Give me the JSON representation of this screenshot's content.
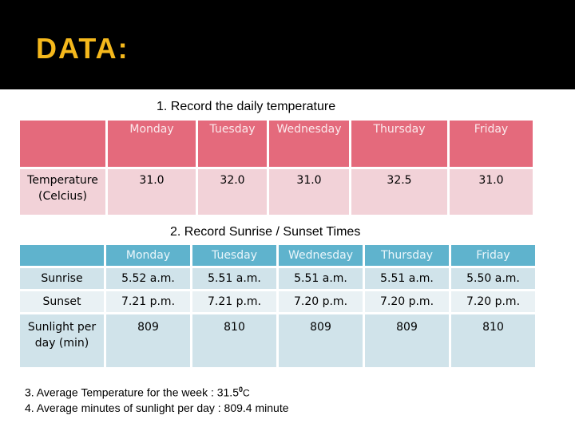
{
  "slide": {
    "title": "DATA:",
    "title_color": "#f5b81c"
  },
  "section1": {
    "caption": "1. Record the daily temperature",
    "header": [
      "",
      "Monday",
      "Tuesday",
      "Wednesday",
      "Thursday",
      "Friday"
    ],
    "rows": [
      {
        "label_line1": "Temperature",
        "label_line2": "(Celcius)",
        "values": [
          "31.0",
          "32.0",
          "31.0",
          "32.5",
          "31.0"
        ]
      }
    ],
    "colors": {
      "header": "#e46a7c",
      "body": "#f2d2d8"
    }
  },
  "section2": {
    "caption": "2. Record Sunrise / Sunset Times",
    "header": [
      "",
      "Monday",
      "Tuesday",
      "Wednesday",
      "Thursday",
      "Friday"
    ],
    "rows": [
      {
        "label_line1": "Sunrise",
        "label_line2": "",
        "values": [
          "5.52 a.m.",
          "5.51 a.m.",
          "5.51 a.m.",
          "5.51 a.m.",
          "5.50 a.m."
        ]
      },
      {
        "label_line1": "Sunset",
        "label_line2": "",
        "values": [
          "7.21 p.m.",
          "7.21 p.m.",
          "7.20 p.m.",
          "7.20 p.m.",
          "7.20  p.m."
        ]
      },
      {
        "label_line1": "Sunlight per",
        "label_line2": "day (min)",
        "values": [
          "809",
          "810",
          "809",
          "809",
          "810"
        ]
      }
    ],
    "colors": {
      "header": "#5fb3cd",
      "row_dark": "#d0e3ea",
      "row_light": "#e9f1f4"
    }
  },
  "notes": {
    "line3_prefix": "3. Average Temperature for the week : 31.5",
    "line3_degree": "0",
    "line3_unit": "C",
    "line4": "4. Average minutes of sunlight per day : 809.4 minute"
  }
}
